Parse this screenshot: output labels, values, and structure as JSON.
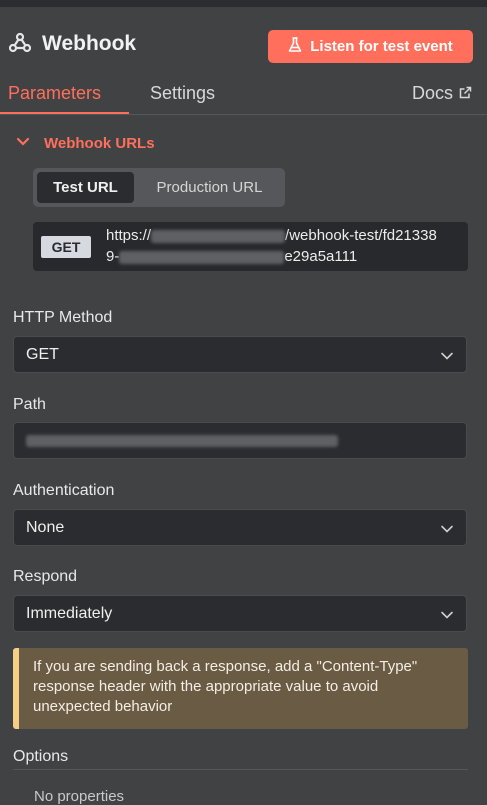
{
  "header": {
    "title": "Webhook",
    "listen_button": "Listen for test event"
  },
  "tabs": {
    "parameters": "Parameters",
    "settings": "Settings",
    "docs": "Docs"
  },
  "webhook_urls": {
    "section_title": "Webhook URLs",
    "toggle": {
      "test": "Test URL",
      "production": "Production URL",
      "selected": "Test URL"
    },
    "method_badge": "GET",
    "url_part1": "https://",
    "url_part2": "/webhook-test/fd21338",
    "url_part3": "9-",
    "url_part4": "e29a5a111"
  },
  "http_method": {
    "label": "HTTP Method",
    "value": "GET"
  },
  "path": {
    "label": "Path"
  },
  "authentication": {
    "label": "Authentication",
    "value": "None"
  },
  "respond": {
    "label": "Respond",
    "value": "Immediately"
  },
  "notice": {
    "text": "If you are sending back a response, add a \"Content-Type\" response header with the appropriate value to avoid unexpected behavior"
  },
  "options": {
    "label": "Options",
    "empty_text": "No properties"
  },
  "colors": {
    "accent": "#ff6f5c",
    "background": "#414244",
    "notice_bg": "#6a5b44",
    "notice_border": "#f5cf86"
  }
}
